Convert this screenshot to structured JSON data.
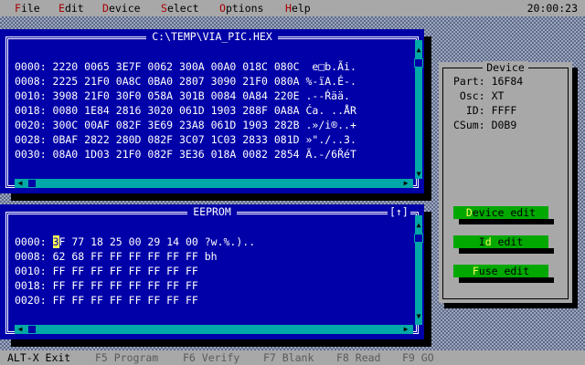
{
  "menu": {
    "items": [
      {
        "hot": "F",
        "rest": "ile"
      },
      {
        "hot": "E",
        "rest": "dit"
      },
      {
        "hot": "D",
        "rest": "evice"
      },
      {
        "hot": "S",
        "rest": "elect"
      },
      {
        "hot": "O",
        "rest": "ptions"
      },
      {
        "hot": "H",
        "rest": "elp"
      }
    ],
    "clock": "20:00:23"
  },
  "hex_window": {
    "title": "C:\\TEMP\\VIA_PIC.HEX",
    "lines": [
      "0000: 2220 0065 3E7F 0062 300A 00A0 018C 080C  e□b.Ãi.",
      "0008: 2225 21F0 0A8C 0BA0 2807 3090 21F0 080A %-ïA.É-.",
      "0010: 3908 21F0 30F0 058A 301B 0084 0A84 220E .--Ŕää.",
      "0018: 0080 1E84 2816 3020 061D 1903 288F 0A8A Ća. ..ÅR",
      "0020: 300C 00AF 082F 3E69 23A8 061D 1903 282B .»/i®..+",
      "0028: 0BAF 2822 280D 082F 3C07 1C03 2833 081D »\"./..3.",
      "0030: 08A0 1D03 21F0 082F 3E36 018A 0082 2854 Ã.-/6ŘéT"
    ]
  },
  "eeprom_window": {
    "title": "EEPROM",
    "scroll_marker": "[↑]",
    "lines": [
      {
        "addr": "0000:",
        "cursor": "3",
        "rest": "F 77 18 25 00 29 14 00 ?w.%.).."
      },
      {
        "addr": "0008:",
        "cursor": "",
        "rest": "62 68 FF FF FF FF FF FF bh"
      },
      {
        "addr": "0010:",
        "cursor": "",
        "rest": "FF FF FF FF FF FF FF FF"
      },
      {
        "addr": "0018:",
        "cursor": "",
        "rest": "FF FF FF FF FF FF FF FF"
      },
      {
        "addr": "0020:",
        "cursor": "",
        "rest": "FF FF FF FF FF FF FF FF"
      }
    ]
  },
  "device": {
    "title": "Device",
    "rows": [
      {
        "label": "Part:",
        "value": "16F84"
      },
      {
        "label": " Osc:",
        "value": "XT"
      },
      {
        "label": "  ID:",
        "value": "FFFF"
      },
      {
        "label": "CSum:",
        "value": "D0B9"
      }
    ],
    "buttons": [
      {
        "hot": "D",
        "rest": "evice edit",
        "pre": ""
      },
      {
        "hot": "d",
        "rest": " edit",
        "pre": "I"
      },
      {
        "hot": "F",
        "rest": "use edit",
        "pre": ""
      }
    ]
  },
  "statusbar": [
    {
      "text": "ALT-X Exit",
      "active": true
    },
    {
      "text": "F5 Program",
      "active": false
    },
    {
      "text": "F6 Verify",
      "active": false
    },
    {
      "text": "F7 Blank",
      "active": false
    },
    {
      "text": "F8 Read",
      "active": false
    },
    {
      "text": "F9 GO",
      "active": false
    }
  ],
  "colors": {
    "window_bg": "#0000a8",
    "scrollbar": "#00a8a8",
    "button_green": "#00a800",
    "menu_hotkey": "#a80000",
    "cursor_yellow": "#fcfc54"
  }
}
